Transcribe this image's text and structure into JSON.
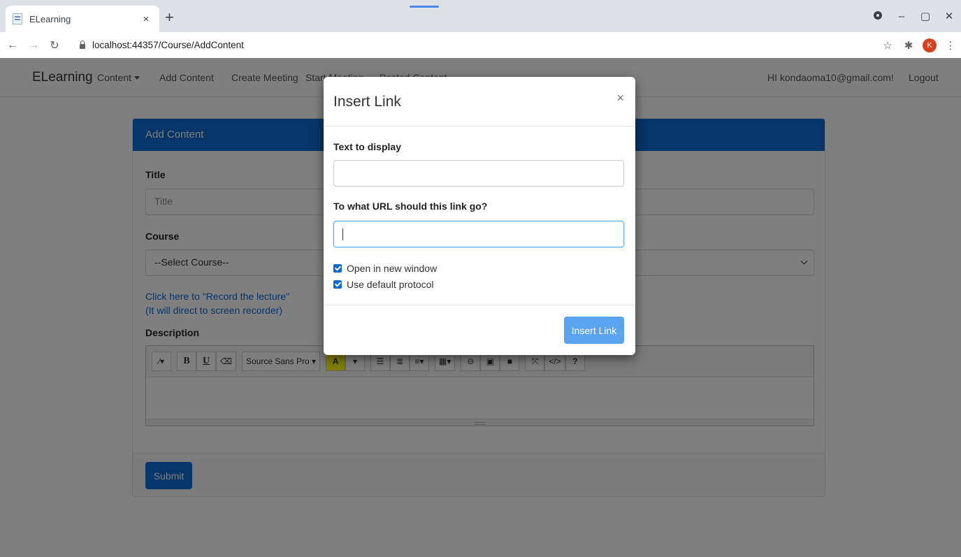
{
  "browser": {
    "tab_title": "ELearning",
    "tab_close": "×",
    "new_tab": "+",
    "url": "localhost:44357/Course/AddContent",
    "profile_initial": "K",
    "colors": {
      "tabstrip": "#dee1e6",
      "avatar": "#d9411e"
    }
  },
  "navbar": {
    "brand": "ELearning",
    "content_menu": "Content",
    "add_content": "Add Content",
    "create_meeting": "Create Meeting",
    "start_meeting": "Start Meeting",
    "posted_content": "Posted Content",
    "greeting": "HI kondaoma10@gmail.com!",
    "logout": "Logout"
  },
  "form": {
    "header": "Add Content",
    "title_label": "Title",
    "title_placeholder": "Title",
    "course_label": "Course",
    "course_selected": "--Select Course--",
    "record_link_line1": "Click here to \"Record the lecture\"",
    "record_link_line2": "(It will direct to screen recorder)",
    "description_label": "Description",
    "submit": "Submit",
    "editor_toolbar": {
      "bold": "B",
      "underline": "U",
      "font_name": "Source Sans Pro",
      "font_color": "A",
      "help": "?"
    },
    "colors": {
      "primary": "#0b6bd3"
    }
  },
  "modal": {
    "title": "Insert Link",
    "close": "×",
    "text_label": "Text to display",
    "text_value": "",
    "url_label": "To what URL should this link go?",
    "url_value": "",
    "open_new_window": "Open in new window",
    "use_default_protocol": "Use default protocol",
    "open_new_window_checked": true,
    "use_default_protocol_checked": true,
    "insert_button": "Insert Link",
    "colors": {
      "insert_button": "#5aa5ee"
    }
  }
}
